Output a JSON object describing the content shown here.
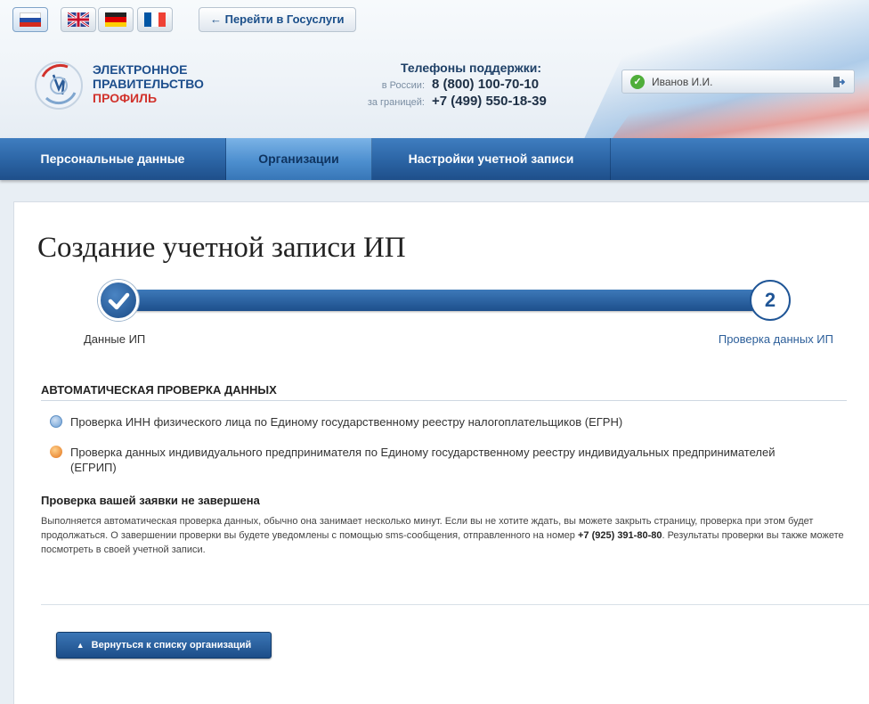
{
  "header": {
    "languages": [
      {
        "name": "ru",
        "active": true
      },
      {
        "name": "en",
        "active": false
      },
      {
        "name": "de",
        "active": false
      },
      {
        "name": "fr",
        "active": false
      }
    ],
    "gosuslugi_link": "← Перейти в Госуслуги",
    "logo": {
      "line1": "ЭЛЕКТРОННОЕ",
      "line2": "ПРАВИТЕЛЬСТВО",
      "line3": "ПРОФИЛЬ"
    },
    "support": {
      "title": "Телефоны поддержки:",
      "russia_caption": "в России:",
      "russia_phone": "8 (800) 100-70-10",
      "abroad_caption": "за границей:",
      "abroad_phone": "+7 (499) 550-18-39"
    },
    "user": {
      "name": "Иванов И.И."
    }
  },
  "nav": {
    "tabs": [
      {
        "label": "Персональные данные",
        "active": false
      },
      {
        "label": "Организации",
        "active": true
      },
      {
        "label": "Настройки учетной записи",
        "active": false
      }
    ]
  },
  "main": {
    "title": "Создание учетной записи ИП",
    "steps": [
      {
        "label": "Данные ИП",
        "status": "done"
      },
      {
        "label": "Проверка данных ИП",
        "number": "2",
        "status": "current"
      }
    ],
    "auto_check_title": "АВТОМАТИЧЕСКАЯ ПРОВЕРКА ДАННЫХ",
    "checks": [
      {
        "text": "Проверка ИНН физического лица по Единому государственному реестру налогоплательщиков (ЕГРН)",
        "status": "in-progress"
      },
      {
        "text": "Проверка данных индивидуального предпринимателя по Единому государственному реестру индивидуальных предпринимателей (ЕГРИП)",
        "status": "pending"
      }
    ],
    "status_title": "Проверка вашей заявки не завершена",
    "status_text_1": "Выполняется автоматическая проверка данных, обычно она занимает несколько минут. Если вы не хотите ждать, вы можете закрыть страницу, проверка при этом будет продолжаться. О завершении проверки вы будете уведомлены с помощью sms-сообщения, отправленного на номер ",
    "status_phone": "+7 (925) 391-80-80",
    "status_text_2": ". Результаты проверки вы также можете посмотреть в своей учетной записи.",
    "back_button": "Вернуться к списку организаций"
  },
  "colors": {
    "nav_blue": "#2b64a4",
    "accent_red": "#d1322c",
    "ok_green": "#4fae3a",
    "pending_orange": "#e2731c"
  }
}
